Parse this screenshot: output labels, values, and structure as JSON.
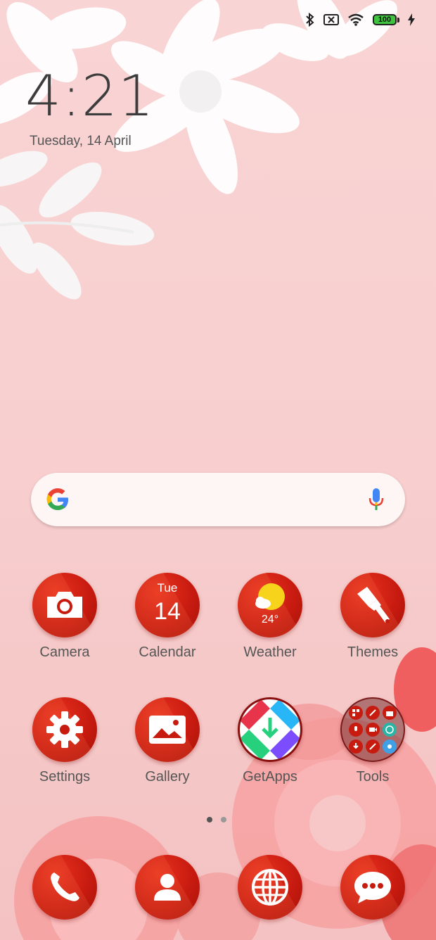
{
  "status_bar": {
    "icons": [
      "bluetooth-icon",
      "no-sim-icon",
      "wifi-icon",
      "battery-icon",
      "charging-icon"
    ],
    "battery_level": "100",
    "battery_color": "#3ec43e"
  },
  "clock": {
    "time": "4:21",
    "date": "Tuesday, 14 April"
  },
  "search": {
    "logo": "google-g-icon",
    "voice": "microphone-icon"
  },
  "apps": [
    {
      "label": "Camera",
      "icon": "camera-icon"
    },
    {
      "label": "Calendar",
      "icon": "calendar-icon",
      "day": "Tue",
      "date": "14"
    },
    {
      "label": "Weather",
      "icon": "weather-icon",
      "temp": "24°"
    },
    {
      "label": "Themes",
      "icon": "paintbrush-icon"
    },
    {
      "label": "Settings",
      "icon": "gear-icon"
    },
    {
      "label": "Gallery",
      "icon": "image-icon"
    },
    {
      "label": "GetApps",
      "icon": "getapps-icon"
    },
    {
      "label": "Tools",
      "icon": "folder-icon"
    }
  ],
  "page_indicator": {
    "pages": 2,
    "current": 1
  },
  "dock": [
    {
      "icon": "phone-icon"
    },
    {
      "icon": "contacts-icon"
    },
    {
      "icon": "browser-globe-icon"
    },
    {
      "icon": "messages-icon"
    }
  ],
  "colors": {
    "accent_red": "#c81b10",
    "background_pink": "#f8cfcf"
  }
}
